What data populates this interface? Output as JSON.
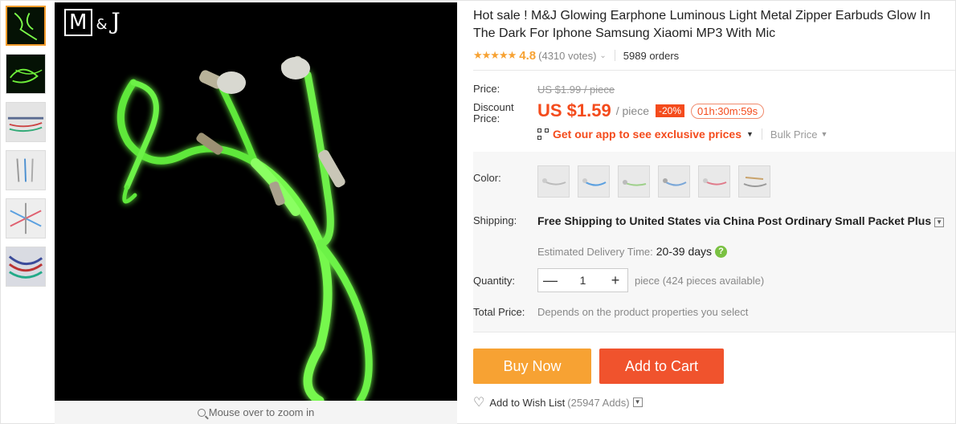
{
  "thumbnails": [
    {
      "name": "thumb-1",
      "active": true
    },
    {
      "name": "thumb-2",
      "active": false
    },
    {
      "name": "thumb-3",
      "active": false
    },
    {
      "name": "thumb-4",
      "active": false
    },
    {
      "name": "thumb-5",
      "active": false
    },
    {
      "name": "thumb-6",
      "active": false
    }
  ],
  "main_image": {
    "brand_m": "M",
    "brand_amp": "&",
    "brand_j": "J",
    "zoom_hint": "Mouse over to zoom in"
  },
  "product": {
    "title": "Hot sale ! M&J Glowing Earphone Luminous Light Metal Zipper Earbuds Glow In The Dark For Iphone Samsung Xiaomi MP3 With Mic",
    "stars": "★★★★★",
    "rating": "4.8",
    "votes": "(4310 votes)",
    "orders": "5989 orders"
  },
  "pricing": {
    "price_label": "Price:",
    "old_price": "US $1.99 / piece",
    "discount_label": "Discount Price:",
    "new_price": "US $1.59",
    "per_piece": "/ piece",
    "discount_pct": "-20%",
    "timer": "01h:30m:59s",
    "app_link": "Get our app to see exclusive prices",
    "bulk_price": "Bulk Price"
  },
  "options": {
    "color_label": "Color:",
    "swatch_count": 6,
    "shipping_label": "Shipping:",
    "shipping_bold": "Free Shipping to United States via China Post Ordinary Small Packet Plus",
    "delivery_label": "Estimated Delivery Time:",
    "delivery_days": "20-39 days",
    "quantity_label": "Quantity:",
    "quantity_value": "1",
    "qty_minus": "—",
    "qty_plus": "+",
    "available": "piece (424 pieces available)",
    "total_label": "Total Price:",
    "total_note": "Depends on the product properties you select"
  },
  "actions": {
    "buy_now": "Buy Now",
    "add_to_cart": "Add to Cart",
    "wishlist": "Add to Wish List",
    "wish_count": "(25947 Adds)"
  },
  "colors": {
    "accent_orange": "#f7a233",
    "cart_red": "#f0532d",
    "price_red": "#f44b1c",
    "glow_green": "#7cff4a"
  }
}
